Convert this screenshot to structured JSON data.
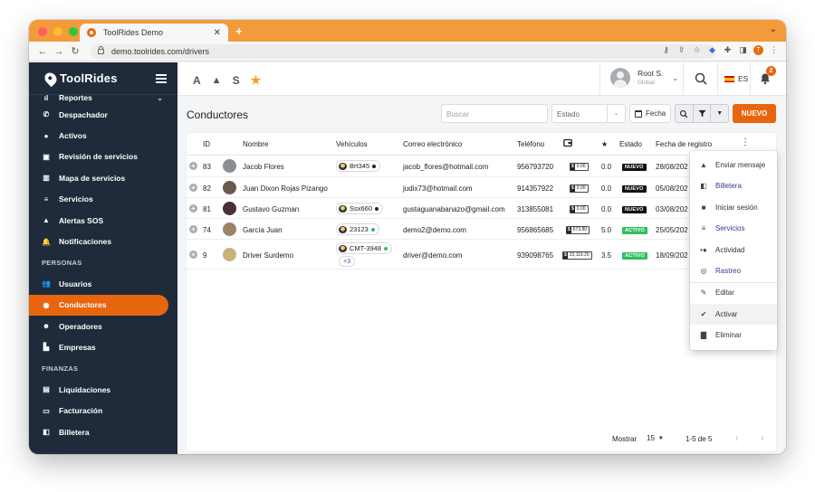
{
  "browser": {
    "tab_title": "ToolRides Demo",
    "tab_close": "✕",
    "new_tab": "+",
    "url": "demo.toolrides.com/drivers",
    "profile_initial": "T"
  },
  "app": {
    "brand": "ToolRides",
    "accent": "#e8650f",
    "sidebar_bg": "#1f2b3a"
  },
  "sidebar": {
    "items": [
      {
        "label": "Reportes",
        "icon": "bar-chart-icon",
        "glyph": "ıl",
        "caret": "⌄"
      },
      {
        "label": "Despachador",
        "icon": "phone-icon",
        "glyph": "✆"
      },
      {
        "label": "Activos",
        "icon": "circle-dot-icon",
        "glyph": "●"
      },
      {
        "label": "Revisión de servicios",
        "icon": "review-icon",
        "glyph": "▣"
      },
      {
        "label": "Mapa de servicios",
        "icon": "map-icon",
        "glyph": "▥"
      },
      {
        "label": "Servicios",
        "icon": "list-icon",
        "glyph": "≡"
      },
      {
        "label": "Alertas SOS",
        "icon": "warning-icon",
        "glyph": "▲"
      },
      {
        "label": "Notificaciones",
        "icon": "bell-icon",
        "glyph": "🔔"
      }
    ],
    "section_personas": "PERSONAS",
    "personas": [
      {
        "label": "Usuarios",
        "icon": "users-icon",
        "glyph": "👥"
      },
      {
        "label": "Conductores",
        "icon": "driver-icon",
        "glyph": "◉",
        "active": true
      },
      {
        "label": "Operadores",
        "icon": "operator-icon",
        "glyph": "☻"
      },
      {
        "label": "Empresas",
        "icon": "building-icon",
        "glyph": "▙"
      }
    ],
    "section_finanzas": "FINANZAS",
    "finanzas": [
      {
        "label": "Liquidaciones",
        "icon": "clipboard-icon",
        "glyph": "▤"
      },
      {
        "label": "Facturación",
        "icon": "card-icon",
        "glyph": "▭"
      },
      {
        "label": "Billetera",
        "icon": "wallet-icon",
        "glyph": "◧"
      }
    ]
  },
  "topbar": {
    "quick_a": "A",
    "quick_s": "S",
    "user_name": "Root S.",
    "user_scope": "Global",
    "lang": "ES",
    "notif_count": "2"
  },
  "page": {
    "title": "Conductores",
    "search_placeholder": "Buscar",
    "estado_placeholder": "Estado",
    "fecha_label": "Fecha",
    "new_button": "NUEVO"
  },
  "table": {
    "headers": {
      "id": "ID",
      "nombre": "Nombre",
      "vehiculos": "Vehículos",
      "correo": "Correo electrónico",
      "telefono": "Teléfono",
      "rating": "★",
      "estado": "Estado",
      "fecha": "Fecha de registro"
    },
    "rows": [
      {
        "id": "83",
        "name": "Jacob Flores",
        "vehicle": "Brt345",
        "vehicle_dot": "#222222",
        "email": "jacob_flores@hotmail.com",
        "phone": "956793720",
        "wallet": "0.00",
        "rating": "0.0",
        "status": "NUEVO",
        "status_color": "#111111",
        "date": "28/08/202",
        "avatar": "#8a8f96"
      },
      {
        "id": "82",
        "name": "Juan Dixon Rojas Pizango",
        "vehicle": "",
        "email": "judix73@hotmail.com",
        "phone": "914357922",
        "wallet": "0.00",
        "rating": "0.0",
        "status": "NUEVO",
        "status_color": "#111111",
        "date": "05/08/202",
        "avatar": "#6b5a4e"
      },
      {
        "id": "81",
        "name": "Gustavo Guzman",
        "vehicle": "Ssx660",
        "vehicle_dot": "#222222",
        "email": "gustaguanabanazo@gmail.com",
        "phone": "313855081",
        "wallet": "0.00",
        "rating": "0.0",
        "status": "NUEVO",
        "status_color": "#111111",
        "date": "03/08/202",
        "avatar": "#4a2f3a"
      },
      {
        "id": "74",
        "name": "García Juan",
        "vehicle": "23123",
        "vehicle_dot": "#2fbf5b",
        "email": "demo2@demo.com",
        "phone": "956865685",
        "wallet": "673.80",
        "rating": "5.0",
        "status": "ACTIVO",
        "status_color": "#2fbf5b",
        "date": "25/05/202",
        "avatar": "#9a8466"
      },
      {
        "id": "9",
        "name": "Driver Surdemo",
        "vehicle": "CMT-3948",
        "vehicle_dot": "#2fbf5b",
        "more": "+3",
        "email": "driver@demo.com",
        "phone": "939098765",
        "wallet": "23,119.20",
        "rating": "3.5",
        "status": "ACTIVO",
        "status_color": "#2fbf5b",
        "date": "18/09/202",
        "avatar": "#c9b37a"
      }
    ],
    "footer": {
      "show_label": "Mostrar",
      "page_size": "15",
      "range": "1-5 de 5"
    }
  },
  "menu": {
    "items": [
      {
        "label": "Enviar mensaje",
        "icon": "bell-icon",
        "glyph": "🔔"
      },
      {
        "label": "Billetera",
        "icon": "wallet-icon",
        "glyph": "◧"
      },
      {
        "label": "Iniciar sesión",
        "icon": "lock-icon",
        "glyph": "🔒"
      },
      {
        "label": "Servicios",
        "icon": "list-icon",
        "glyph": "≡"
      },
      {
        "label": "Actividad",
        "icon": "activity-icon",
        "glyph": "•●"
      },
      {
        "label": "Rastreo",
        "icon": "target-icon",
        "glyph": "◎"
      },
      {
        "label": "Editar",
        "icon": "pencil-icon",
        "glyph": "✎"
      },
      {
        "label": "Activar",
        "icon": "check-circle-icon",
        "glyph": "✔"
      },
      {
        "label": "Eliminar",
        "icon": "trash-icon",
        "glyph": "🗑"
      }
    ]
  }
}
